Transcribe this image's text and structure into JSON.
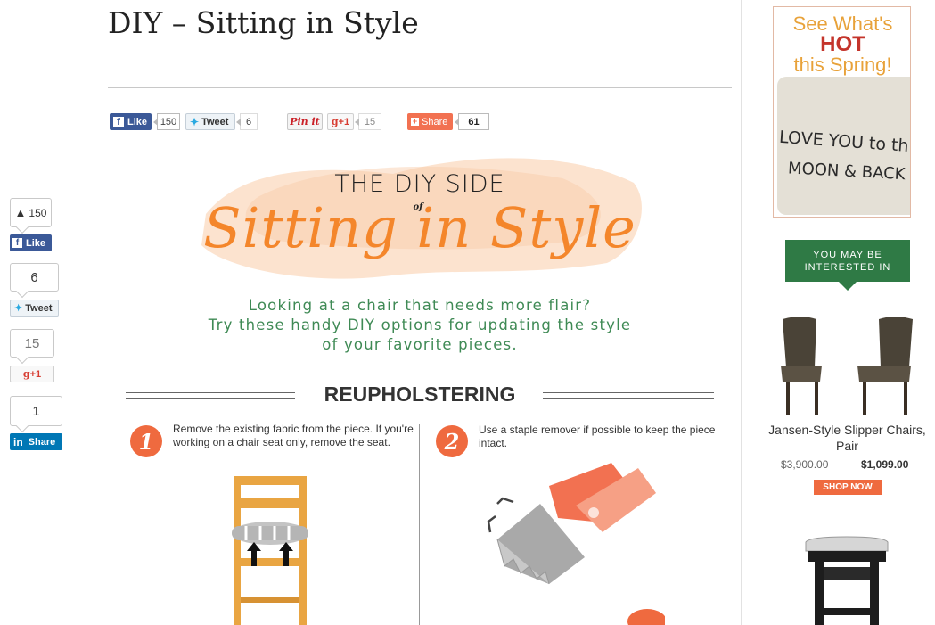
{
  "article": {
    "title": "DIY – Sitting in Style"
  },
  "share_bar": {
    "facebook": {
      "label": "Like",
      "count": "150"
    },
    "twitter": {
      "label": "Tweet",
      "count": "6"
    },
    "pinterest": {
      "label": "Pin it"
    },
    "gplus": {
      "label": "+1",
      "count": "15"
    },
    "share": {
      "label": "Share",
      "count": "61"
    }
  },
  "floating_share": {
    "facebook": {
      "count": "150",
      "label": "Like"
    },
    "twitter": {
      "count": "6",
      "label": "Tweet"
    },
    "gplus": {
      "count": "15",
      "label": "+1"
    },
    "linkedin": {
      "count": "1",
      "label": "Share"
    }
  },
  "infographic": {
    "kicker_top": "THE DIY SIDE",
    "kicker_of": "of",
    "headline": "Sitting in Style",
    "intro_lines": [
      "Looking at a chair that needs more flair?",
      "Try these handy DIY options for updating the style",
      "of your favorite pieces."
    ],
    "section_title": "REUPHOLSTERING",
    "steps": [
      {
        "number": "1",
        "text": "Remove the existing fabric from the piece. If you're working on a chair seat only, remove the seat."
      },
      {
        "number": "2",
        "text": "Use a staple remover if possible to keep the piece intact."
      }
    ],
    "colors": {
      "accent": "#ef6a3f",
      "green": "#3f8a55",
      "wash": "#fbd9bf"
    }
  },
  "sidebar": {
    "ad": {
      "line1": "See What's",
      "line2": "HOT",
      "line3": "this Spring!",
      "pillow_line1": "LOVE YOU to th",
      "pillow_line2": "MOON & BACK"
    },
    "related_header_line1": "YOU MAY BE",
    "related_header_line2": "INTERESTED IN",
    "product": {
      "name": "Jansen-Style Slipper Chairs, Pair",
      "old_price": "$3,900.00",
      "price": "$1,099.00",
      "cta": "SHOP NOW"
    },
    "brand_colors": {
      "green": "#2f7a45",
      "orange": "#ef6a3f"
    }
  }
}
